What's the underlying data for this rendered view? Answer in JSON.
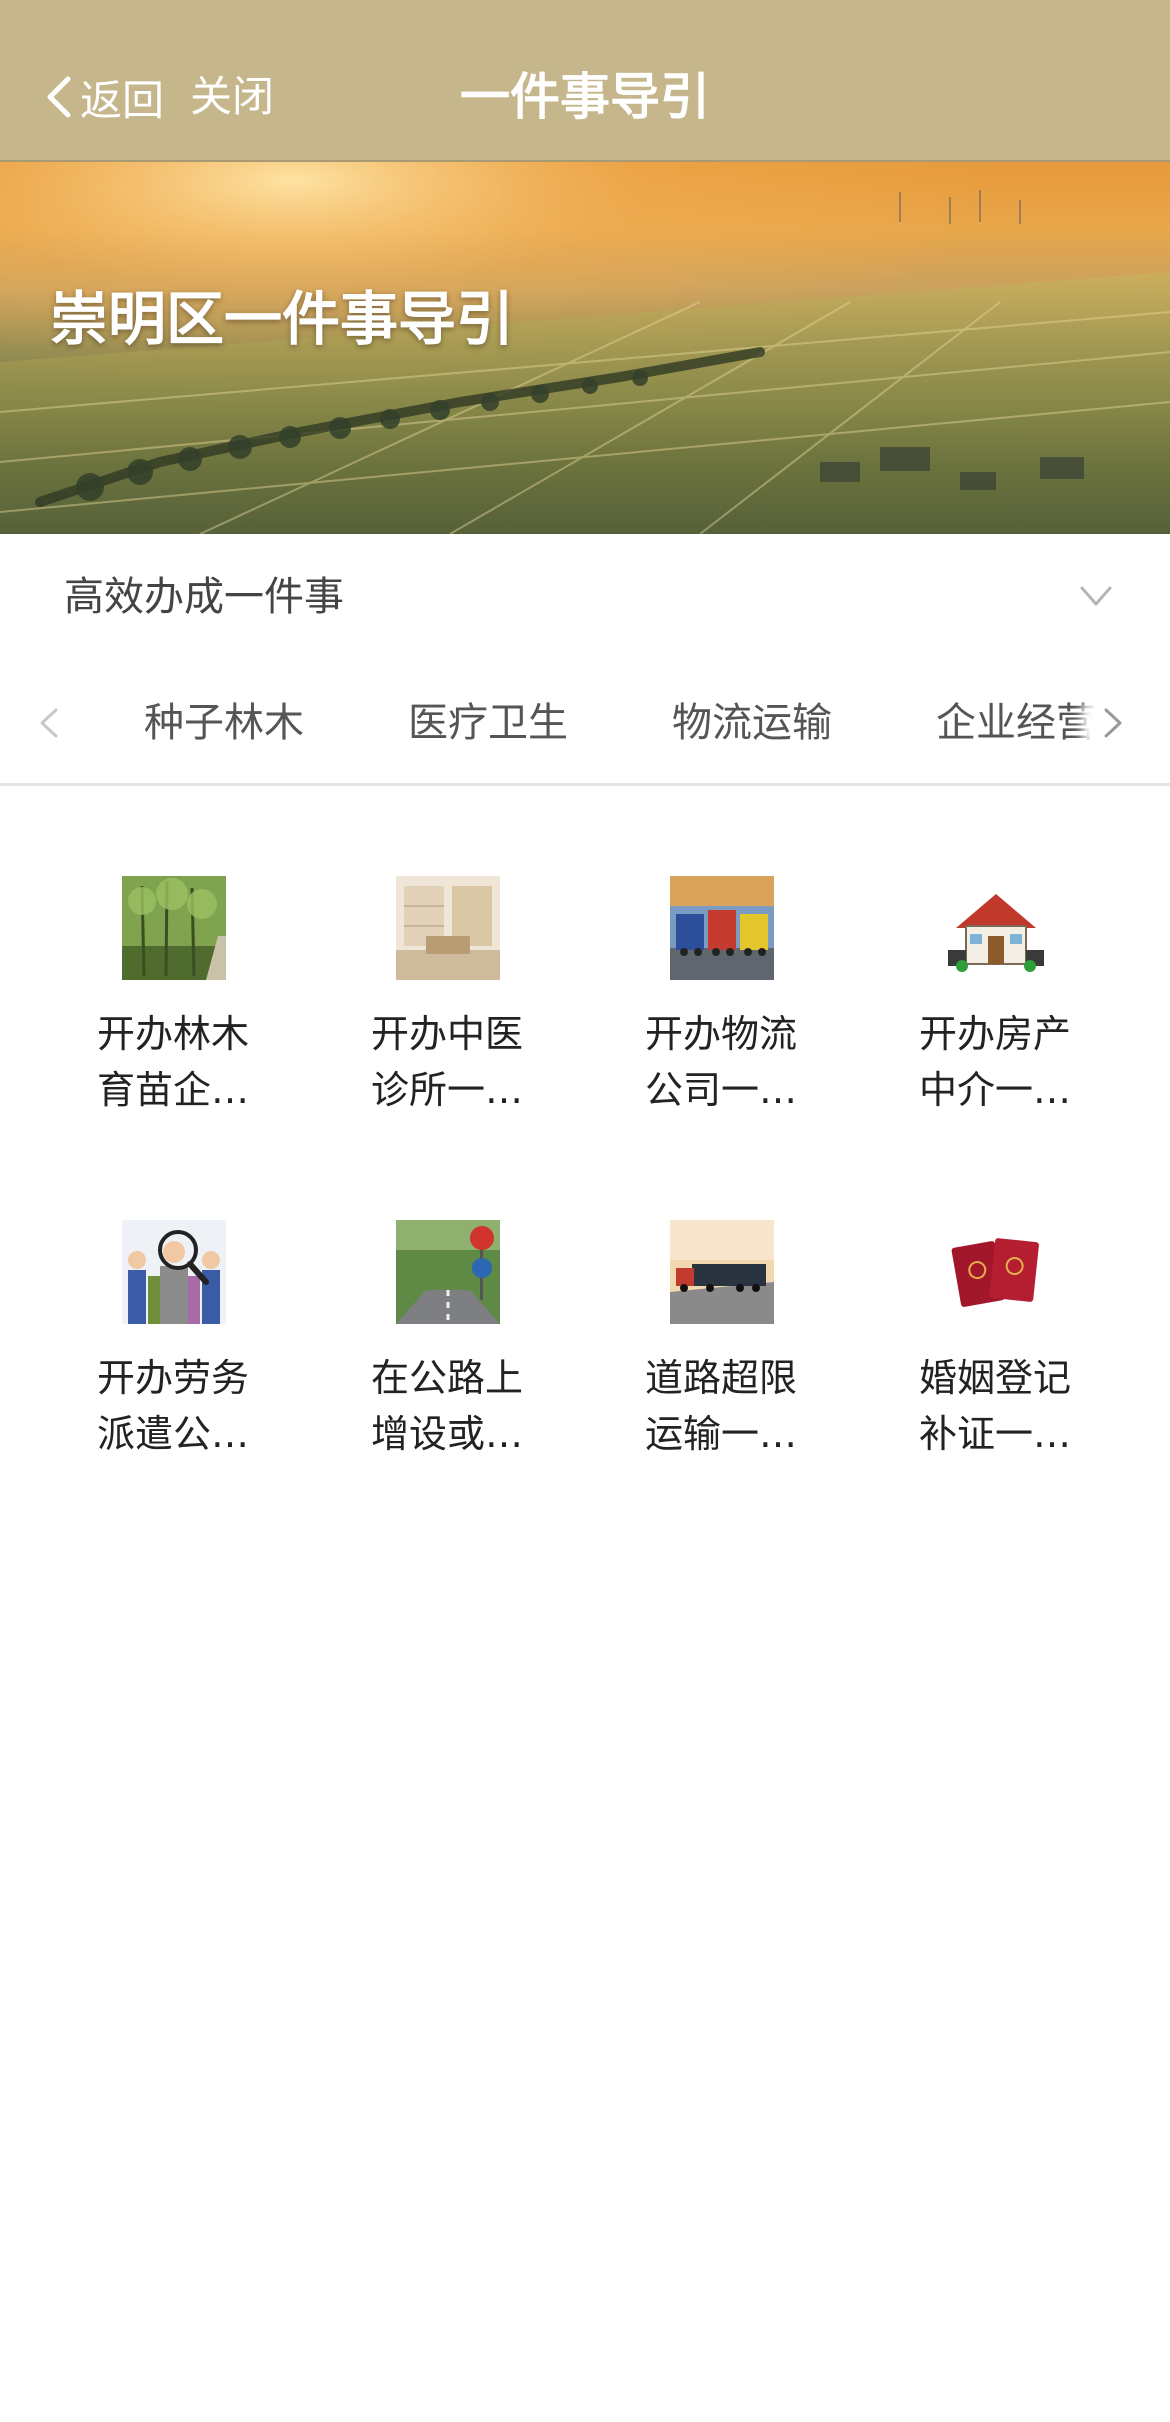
{
  "navbar": {
    "back_label": "返回",
    "close_label": "关闭",
    "title": "一件事导引",
    "background": "#c6b68b"
  },
  "banner": {
    "title": "崇明区一件事导引"
  },
  "category": {
    "label": "高效办成一件事"
  },
  "tabs": [
    {
      "label": "种子林木"
    },
    {
      "label": "医疗卫生"
    },
    {
      "label": "物流运输"
    },
    {
      "label": "企业经营"
    }
  ],
  "items": [
    {
      "line1": "开办林木",
      "line2": "育苗企…",
      "icon": "forest-icon"
    },
    {
      "line1": "开办中医",
      "line2": "诊所一…",
      "icon": "clinic-icon"
    },
    {
      "line1": "开办物流",
      "line2": "公司一…",
      "icon": "trucks-icon"
    },
    {
      "line1": "开办房产",
      "line2": "中介一…",
      "icon": "house-icon"
    },
    {
      "line1": "开办劳务",
      "line2": "派遣公…",
      "icon": "workers-magnifier-icon"
    },
    {
      "line1": "在公路上",
      "line2": "增设或…",
      "icon": "road-sign-icon"
    },
    {
      "line1": "道路超限",
      "line2": "运输一…",
      "icon": "truck-road-icon"
    },
    {
      "line1": "婚姻登记",
      "line2": "补证一…",
      "icon": "marriage-certificate-icon"
    }
  ]
}
